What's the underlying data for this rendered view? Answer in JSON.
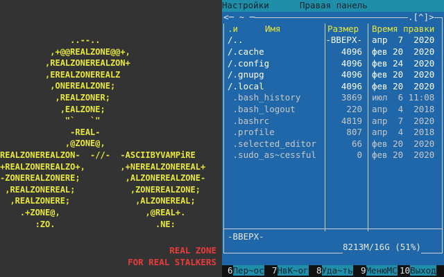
{
  "art": {
    "lines": [
      "              ..--..",
      "          ,+@@REALZONE@@+,",
      "         ,REALZONEREALZON+",
      "         ,EREALZONEREALZ",
      "          ,ONEREALZONE;",
      "           ,REALZONER;",
      "            ,EALZONE;",
      "             \"`   `\"",
      "              -REAL-",
      "             ,@ZONE@,",
      "REALZONEREALZON-  -//-  -ASCIIBYVAMPiRE",
      "+REALZONEREALZO+,       ,+NEREALZONEREAL+",
      "-ZONEREALZONERE;         ,ALZONEREALZONE-",
      " ,REALZONEREAL;           ,ZONEREALZONE;",
      "  ,REALZONERE;             ,ALZONEREAL;",
      "    .+ZONE@,                 ,@REAL+.",
      "       :ZO.                    .NE:"
    ],
    "slogan_line1": "REAL ZONE",
    "slogan_line2": "FOR REAL STALKERS"
  },
  "menubar": {
    "settings": "Настройки",
    "right_panel": "Правая панель"
  },
  "panel": {
    "top_left": "<─ ~ ─",
    "top_right": ".[^]>",
    "headers": {
      "sort": ".и",
      "name": "Имя",
      "size": "Размер",
      "time": "Время правки"
    },
    "rows": [
      {
        "name": "/..",
        "size": "-ВВЕРХ-",
        "time": "апр  7  2020",
        "kind": "dir"
      },
      {
        "name": "/.cache",
        "size": "4096",
        "time": "фев 20  2020",
        "kind": "dir"
      },
      {
        "name": "/.config",
        "size": "4096",
        "time": "фев 24  2020",
        "kind": "dir"
      },
      {
        "name": "/.gnupg",
        "size": "4096",
        "time": "фев 20  2020",
        "kind": "dir"
      },
      {
        "name": "/.local",
        "size": "4096",
        "time": "фев 20  2020",
        "kind": "dir"
      },
      {
        "name": " .bash_history",
        "size": "3869",
        "time": "июл  6 11:08",
        "kind": "file"
      },
      {
        "name": " .bash_logout",
        "size": "220",
        "time": "апр  4  2018",
        "kind": "file"
      },
      {
        "name": " .bashrc",
        "size": "4819",
        "time": "апр  7  2020",
        "kind": "file"
      },
      {
        "name": " .profile",
        "size": "807",
        "time": "апр  4  2018",
        "kind": "file"
      },
      {
        "name": " .selected_editor",
        "size": "66",
        "time": "фев 20  2020",
        "kind": "file"
      },
      {
        "name": " .sudo_as~cessful",
        "size": "0",
        "time": "фев 20  2020",
        "kind": "file"
      }
    ],
    "status": "-ВВЕРХ-",
    "disk": "8213M/16G (51%)"
  },
  "fkeys": [
    {
      "num": "6",
      "label": "Пер~ос"
    },
    {
      "num": "7",
      "label": "НвК~ог"
    },
    {
      "num": "8",
      "label": "Уда~ть"
    },
    {
      "num": "9",
      "label": "МенюMC"
    },
    {
      "num": "10",
      "label": "Выход"
    }
  ],
  "colors": {
    "art": "#e8e83c",
    "slogan": "#e83c3c",
    "panel_bg": "#1f67a8",
    "menubar_bg": "#1f8ea8",
    "header": "#e8e838"
  }
}
